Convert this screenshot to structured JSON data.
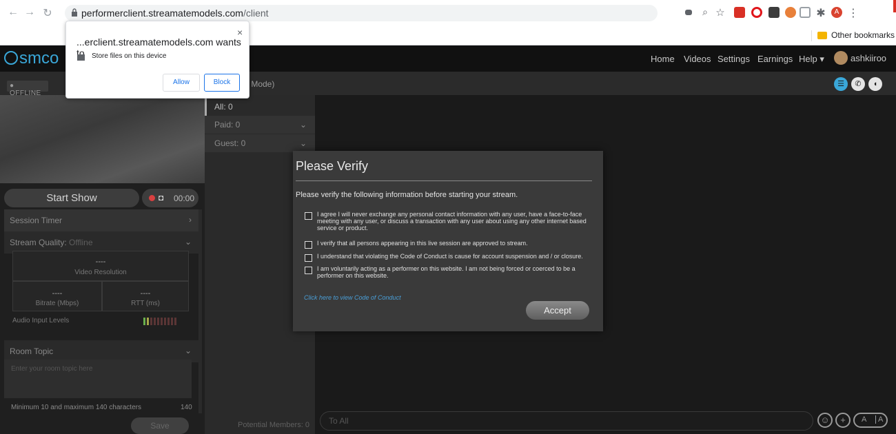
{
  "browser": {
    "url_host": "performerclient.streamatemodels.com",
    "url_path": "/client",
    "bookmarks_other": "Other bookmarks",
    "profile_initial": "A"
  },
  "permission": {
    "title": "...erclient.streamatemodels.com wants to",
    "item": "Store files on this device",
    "allow": "Allow",
    "block": "Block",
    "close": "×"
  },
  "app": {
    "logo": "smco",
    "nav": [
      "Home",
      "Videos",
      "Settings",
      "Earnings",
      "Help"
    ],
    "help_caret": "▾",
    "username": "ashkiiroo"
  },
  "video": {
    "status": "● OFFLINE",
    "start_show": "Start Show",
    "timer": "00:00"
  },
  "panels": {
    "session_timer": "Session Timer",
    "stream_quality": "Stream Quality:",
    "stream_status": "Offline",
    "resolution_value": "----",
    "resolution_label": "Video Resolution",
    "bitrate_value": "----",
    "bitrate_label": "Bitrate (Mbps)",
    "rtt_value": "----",
    "rtt_label": "RTT (ms)",
    "audio_label": "Audio Input Levels",
    "room_topic": "Room Topic",
    "topic_placeholder": "Enter your room topic here",
    "topic_help": "Minimum 10 and maximum 140 characters",
    "topic_count": "140",
    "save": "Save"
  },
  "chat": {
    "title": "y Mode)",
    "members": [
      {
        "label": "All: 0"
      },
      {
        "label": "Paid: 0"
      },
      {
        "label": "Guest: 0"
      }
    ],
    "potential": "Potential Members: 0",
    "input_placeholder": "To All"
  },
  "modal": {
    "title": "Please Verify",
    "intro": "Please verify the following information before starting your stream.",
    "checks": [
      "I agree I will never exchange any personal contact information with any user, have a face-to-face meeting with any user, or discuss a transaction with any user about using any other internet based service or product.",
      "I verify that all persons appearing in this live session are approved to stream.",
      "I understand that violating the Code of Conduct is cause for account suspension and / or closure.",
      "I am voluntarily acting as a performer on this website. I am not being forced or coerced to be a performer on this website."
    ],
    "link": "Click here to view Code of Conduct",
    "accept": "Accept"
  },
  "colors": {
    "accent": "#3aa7d8",
    "record": "#d94040",
    "link": "#4a9fd8"
  }
}
